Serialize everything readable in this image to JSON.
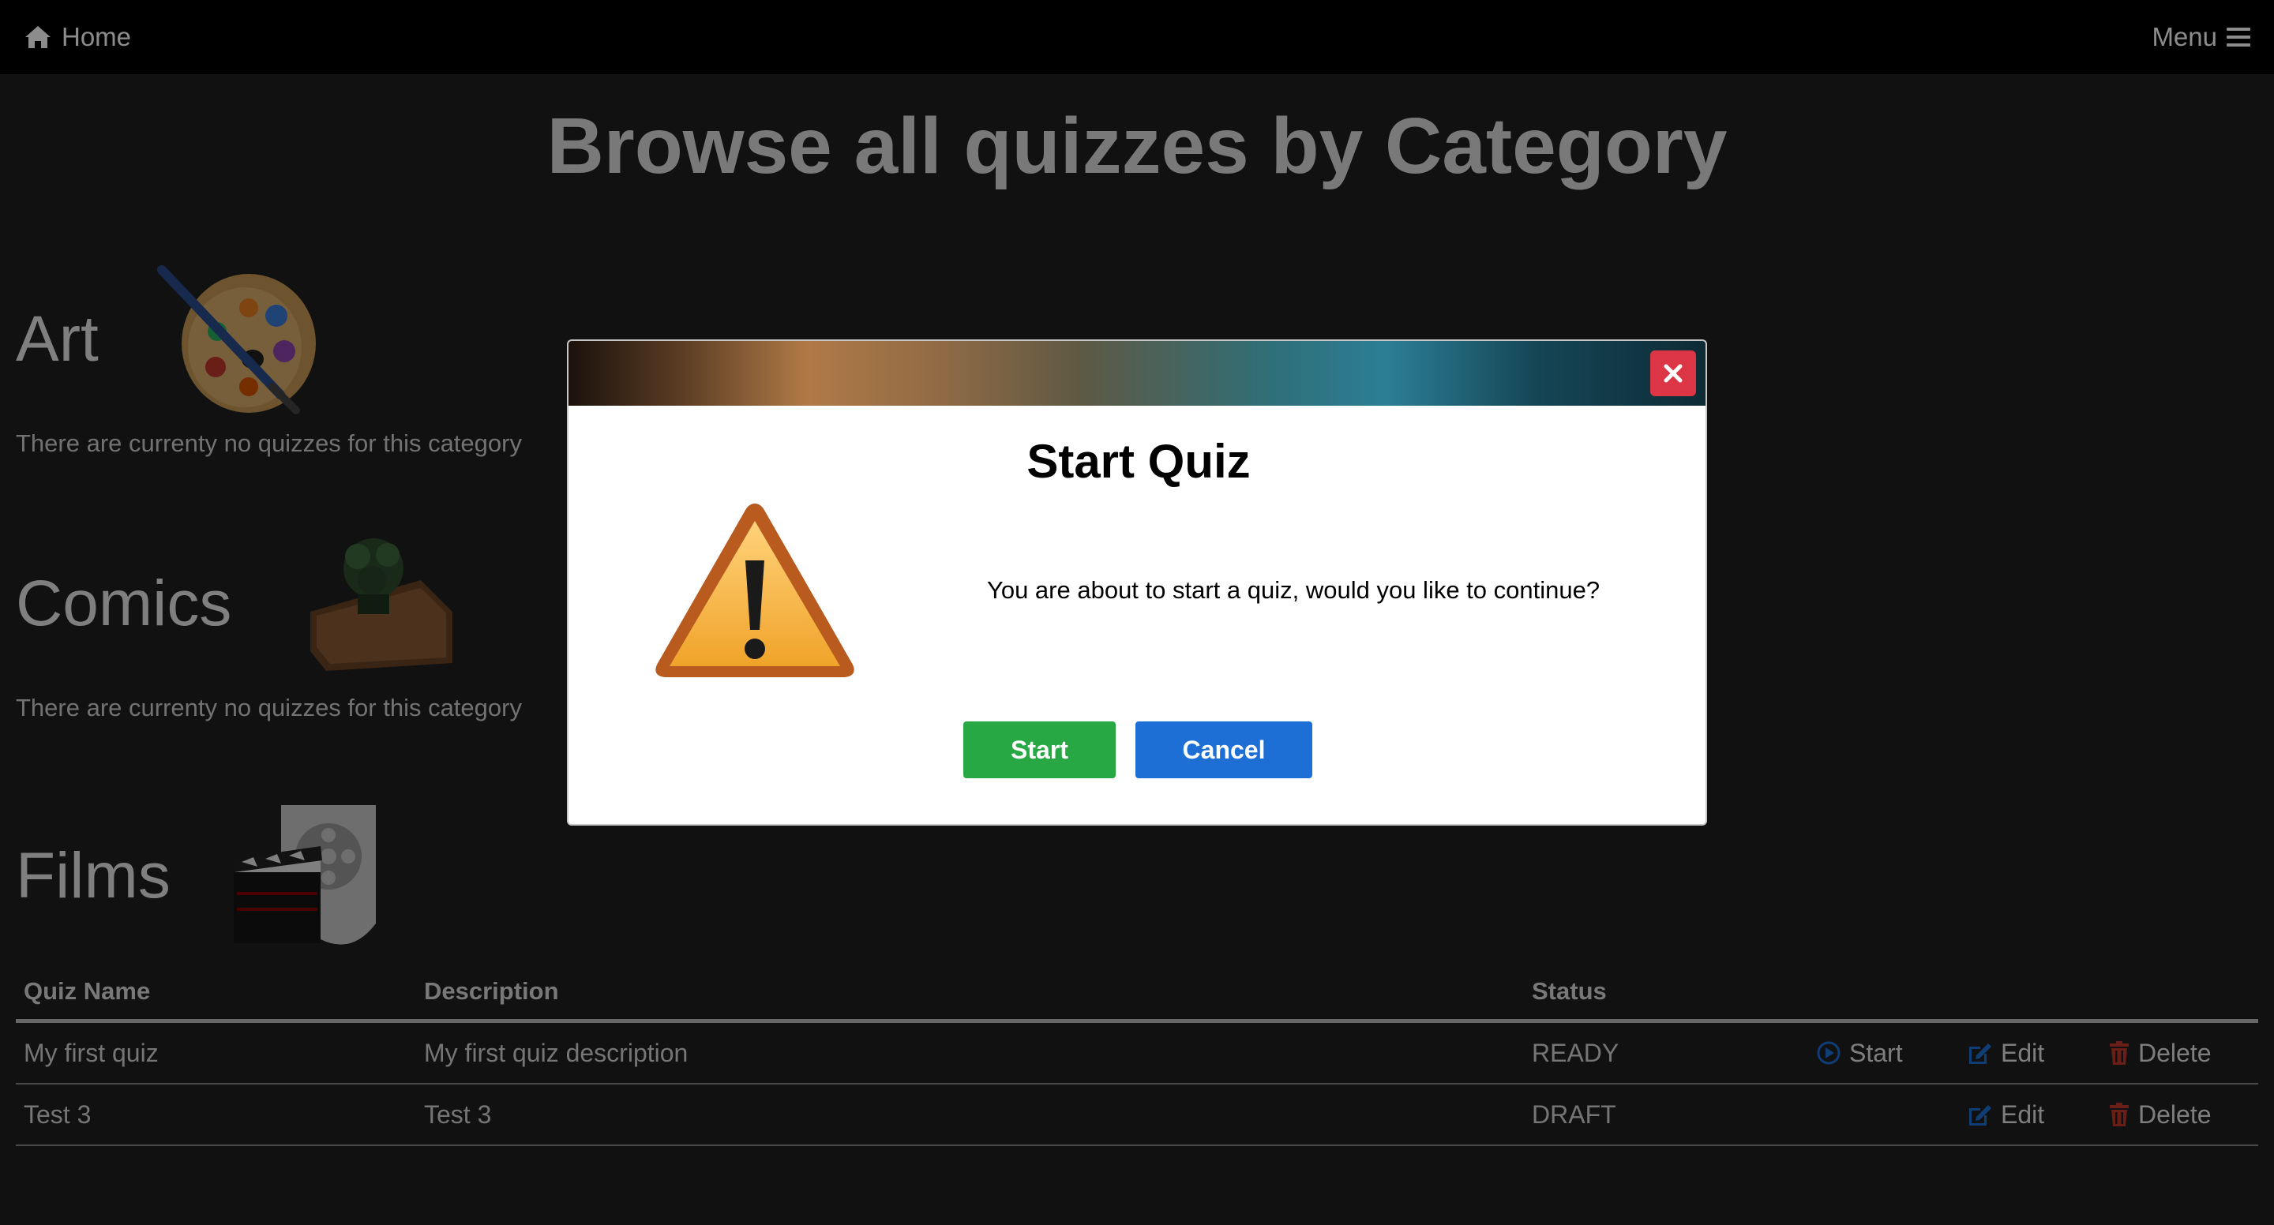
{
  "nav": {
    "home_label": "Home",
    "menu_label": "Menu"
  },
  "page": {
    "title": "Browse all quizzes by Category"
  },
  "categories": [
    {
      "name": "Art",
      "empty_text": "There are currenty no quizzes for this category",
      "icon": "palette-icon"
    },
    {
      "name": "Comics",
      "empty_text": "There are currenty no quizzes for this category",
      "icon": "comics-folder-icon"
    },
    {
      "name": "Films",
      "icon": "film-clapper-icon"
    }
  ],
  "table": {
    "headers": {
      "name": "Quiz Name",
      "description": "Description",
      "status": "Status"
    },
    "rows": [
      {
        "name": "My first quiz",
        "description": "My first quiz description",
        "status": "READY",
        "start": "Start",
        "edit": "Edit",
        "delete": "Delete"
      },
      {
        "name": "Test 3",
        "description": "Test 3",
        "status": "DRAFT",
        "edit": "Edit",
        "delete": "Delete"
      }
    ],
    "colors": {
      "start": "#1d6fd6",
      "edit": "#1d6fd6",
      "delete": "#c0392b"
    }
  },
  "modal": {
    "title": "Start Quiz",
    "message": "You are about to start a quiz, would you like to continue?",
    "start_label": "Start",
    "cancel_label": "Cancel",
    "icon": "warning-icon",
    "colors": {
      "start": "#28a745",
      "cancel": "#1d6fd6",
      "close": "#dc3545"
    }
  }
}
